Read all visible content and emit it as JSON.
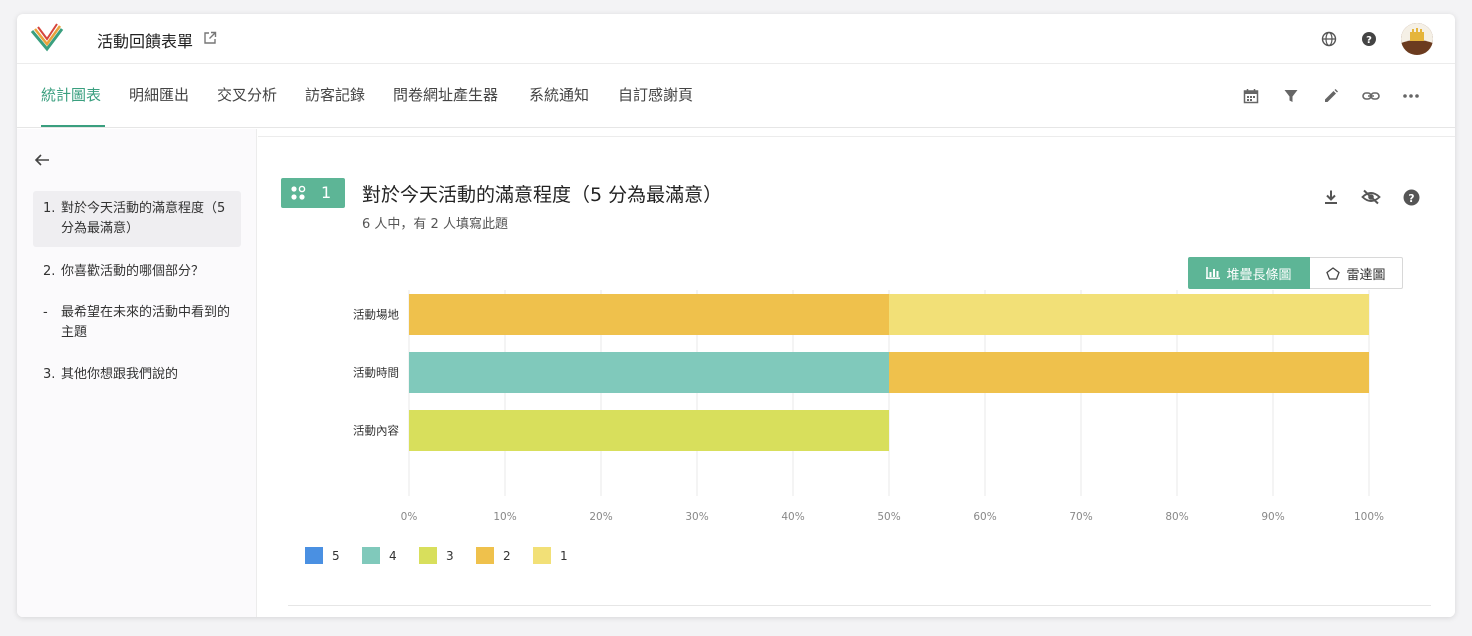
{
  "app": {
    "title": "活動回饋表單"
  },
  "tabs": [
    {
      "label": "統計圖表",
      "active": true
    },
    {
      "label": "明細匯出"
    },
    {
      "label": "交叉分析"
    },
    {
      "label": "訪客記錄"
    },
    {
      "label": "問卷網址產生器"
    },
    {
      "label": "系統通知"
    },
    {
      "label": "自訂感謝頁"
    }
  ],
  "icons": {
    "top": [
      "globe-icon",
      "help-icon",
      "avatar"
    ],
    "tab_tools": [
      "calendar-icon",
      "filter-icon",
      "edit-icon",
      "link-icon",
      "more-icon"
    ],
    "question_tools": [
      "download-icon",
      "hide-icon",
      "help-icon"
    ]
  },
  "sidebar": {
    "items": [
      {
        "num": "1.",
        "text": "對於今天活動的滿意程度（5 分為最滿意）",
        "active": true
      },
      {
        "num": "2.",
        "text": "你喜歡活動的哪個部分？"
      },
      {
        "num": "-",
        "text": "最希望在未來的活動中看到的主題"
      },
      {
        "num": "3.",
        "text": "其他你想跟我們說的"
      }
    ]
  },
  "question": {
    "number": "1",
    "title": "對於今天活動的滿意程度（5 分為最滿意）",
    "subtitle": "6 人中，有 2 人填寫此題",
    "view_stacked": "堆疊長條圖",
    "view_radar": "雷達圖"
  },
  "chart_data": {
    "type": "bar",
    "orientation": "horizontal",
    "stacked": true,
    "categories": [
      "活動場地",
      "活動時間",
      "活動內容"
    ],
    "series": [
      {
        "name": "5",
        "color": "#4a90e2",
        "values": [
          0,
          0,
          0
        ]
      },
      {
        "name": "4",
        "color": "#80c9bb",
        "values": [
          0,
          50,
          0
        ]
      },
      {
        "name": "3",
        "color": "#d8df5c",
        "values": [
          0,
          0,
          50
        ]
      },
      {
        "name": "2",
        "color": "#efc14c",
        "values": [
          50,
          50,
          0
        ]
      },
      {
        "name": "1",
        "color": "#f2e077",
        "values": [
          50,
          0,
          0
        ]
      }
    ],
    "x_ticks": [
      "0%",
      "10%",
      "20%",
      "30%",
      "40%",
      "50%",
      "60%",
      "70%",
      "80%",
      "90%",
      "100%"
    ],
    "xlim": [
      0,
      100
    ],
    "grid": true,
    "legend_position": "bottom-left"
  }
}
